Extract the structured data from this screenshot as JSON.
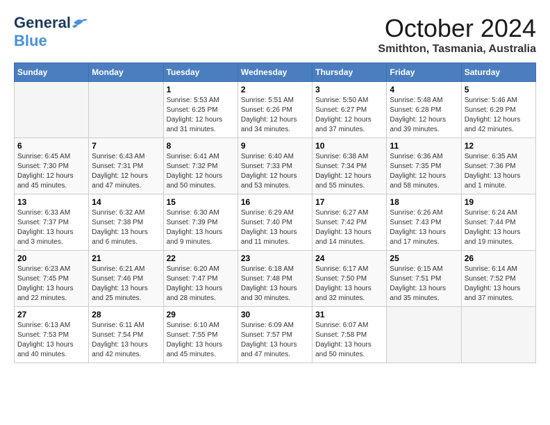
{
  "logo": {
    "general": "General",
    "blue": "Blue"
  },
  "header": {
    "month": "October 2024",
    "location": "Smithton, Tasmania, Australia"
  },
  "weekdays": [
    "Sunday",
    "Monday",
    "Tuesday",
    "Wednesday",
    "Thursday",
    "Friday",
    "Saturday"
  ],
  "weeks": [
    [
      {
        "day": "",
        "info": ""
      },
      {
        "day": "",
        "info": ""
      },
      {
        "day": "1",
        "info": "Sunrise: 5:53 AM\nSunset: 6:25 PM\nDaylight: 12 hours\nand 31 minutes."
      },
      {
        "day": "2",
        "info": "Sunrise: 5:51 AM\nSunset: 6:26 PM\nDaylight: 12 hours\nand 34 minutes."
      },
      {
        "day": "3",
        "info": "Sunrise: 5:50 AM\nSunset: 6:27 PM\nDaylight: 12 hours\nand 37 minutes."
      },
      {
        "day": "4",
        "info": "Sunrise: 5:48 AM\nSunset: 6:28 PM\nDaylight: 12 hours\nand 39 minutes."
      },
      {
        "day": "5",
        "info": "Sunrise: 5:46 AM\nSunset: 6:29 PM\nDaylight: 12 hours\nand 42 minutes."
      }
    ],
    [
      {
        "day": "6",
        "info": "Sunrise: 6:45 AM\nSunset: 7:30 PM\nDaylight: 12 hours\nand 45 minutes."
      },
      {
        "day": "7",
        "info": "Sunrise: 6:43 AM\nSunset: 7:31 PM\nDaylight: 12 hours\nand 47 minutes."
      },
      {
        "day": "8",
        "info": "Sunrise: 6:41 AM\nSunset: 7:32 PM\nDaylight: 12 hours\nand 50 minutes."
      },
      {
        "day": "9",
        "info": "Sunrise: 6:40 AM\nSunset: 7:33 PM\nDaylight: 12 hours\nand 53 minutes."
      },
      {
        "day": "10",
        "info": "Sunrise: 6:38 AM\nSunset: 7:34 PM\nDaylight: 12 hours\nand 55 minutes."
      },
      {
        "day": "11",
        "info": "Sunrise: 6:36 AM\nSunset: 7:35 PM\nDaylight: 12 hours\nand 58 minutes."
      },
      {
        "day": "12",
        "info": "Sunrise: 6:35 AM\nSunset: 7:36 PM\nDaylight: 13 hours\nand 1 minute."
      }
    ],
    [
      {
        "day": "13",
        "info": "Sunrise: 6:33 AM\nSunset: 7:37 PM\nDaylight: 13 hours\nand 3 minutes."
      },
      {
        "day": "14",
        "info": "Sunrise: 6:32 AM\nSunset: 7:38 PM\nDaylight: 13 hours\nand 6 minutes."
      },
      {
        "day": "15",
        "info": "Sunrise: 6:30 AM\nSunset: 7:39 PM\nDaylight: 13 hours\nand 9 minutes."
      },
      {
        "day": "16",
        "info": "Sunrise: 6:29 AM\nSunset: 7:40 PM\nDaylight: 13 hours\nand 11 minutes."
      },
      {
        "day": "17",
        "info": "Sunrise: 6:27 AM\nSunset: 7:42 PM\nDaylight: 13 hours\nand 14 minutes."
      },
      {
        "day": "18",
        "info": "Sunrise: 6:26 AM\nSunset: 7:43 PM\nDaylight: 13 hours\nand 17 minutes."
      },
      {
        "day": "19",
        "info": "Sunrise: 6:24 AM\nSunset: 7:44 PM\nDaylight: 13 hours\nand 19 minutes."
      }
    ],
    [
      {
        "day": "20",
        "info": "Sunrise: 6:23 AM\nSunset: 7:45 PM\nDaylight: 13 hours\nand 22 minutes."
      },
      {
        "day": "21",
        "info": "Sunrise: 6:21 AM\nSunset: 7:46 PM\nDaylight: 13 hours\nand 25 minutes."
      },
      {
        "day": "22",
        "info": "Sunrise: 6:20 AM\nSunset: 7:47 PM\nDaylight: 13 hours\nand 28 minutes."
      },
      {
        "day": "23",
        "info": "Sunrise: 6:18 AM\nSunset: 7:48 PM\nDaylight: 13 hours\nand 30 minutes."
      },
      {
        "day": "24",
        "info": "Sunrise: 6:17 AM\nSunset: 7:50 PM\nDaylight: 13 hours\nand 32 minutes."
      },
      {
        "day": "25",
        "info": "Sunrise: 6:15 AM\nSunset: 7:51 PM\nDaylight: 13 hours\nand 35 minutes."
      },
      {
        "day": "26",
        "info": "Sunrise: 6:14 AM\nSunset: 7:52 PM\nDaylight: 13 hours\nand 37 minutes."
      }
    ],
    [
      {
        "day": "27",
        "info": "Sunrise: 6:13 AM\nSunset: 7:53 PM\nDaylight: 13 hours\nand 40 minutes."
      },
      {
        "day": "28",
        "info": "Sunrise: 6:11 AM\nSunset: 7:54 PM\nDaylight: 13 hours\nand 42 minutes."
      },
      {
        "day": "29",
        "info": "Sunrise: 6:10 AM\nSunset: 7:55 PM\nDaylight: 13 hours\nand 45 minutes."
      },
      {
        "day": "30",
        "info": "Sunrise: 6:09 AM\nSunset: 7:57 PM\nDaylight: 13 hours\nand 47 minutes."
      },
      {
        "day": "31",
        "info": "Sunrise: 6:07 AM\nSunset: 7:58 PM\nDaylight: 13 hours\nand 50 minutes."
      },
      {
        "day": "",
        "info": ""
      },
      {
        "day": "",
        "info": ""
      }
    ]
  ]
}
